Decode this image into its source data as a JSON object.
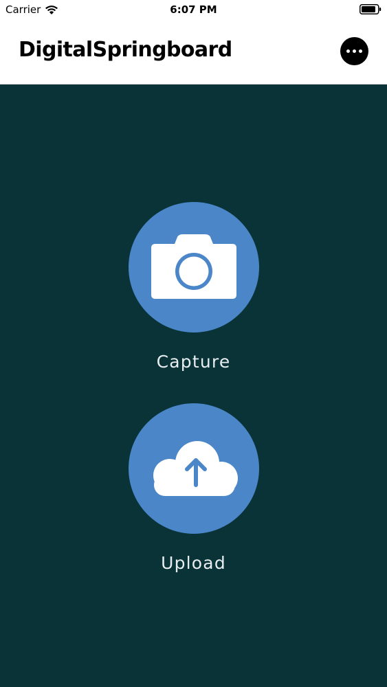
{
  "status_bar": {
    "carrier": "Carrier",
    "time": "6:07 PM"
  },
  "header": {
    "title": "DigitalSpringboard",
    "more_icon": "ellipsis-icon"
  },
  "actions": [
    {
      "label": "Capture",
      "icon": "camera-icon"
    },
    {
      "label": "Upload",
      "icon": "cloud-upload-icon"
    }
  ],
  "colors": {
    "background": "#0a3338",
    "accent": "#4a86c8",
    "header_bg": "#ffffff"
  }
}
